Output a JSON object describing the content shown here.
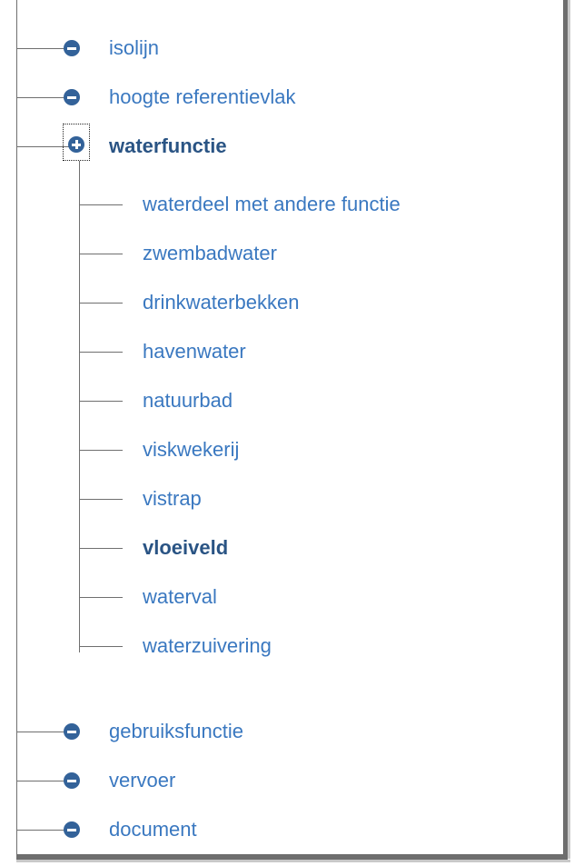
{
  "colors": {
    "link": "#3a78c0",
    "selected": "#2a5484",
    "icon": "#336299",
    "line": "#6f6f6f"
  },
  "tree": {
    "top_items": [
      {
        "label": "isolijn",
        "icon": "minus-circle-icon"
      },
      {
        "label": "hoogte referentievlak",
        "icon": "minus-circle-icon"
      }
    ],
    "expanded": {
      "label": "waterfunctie",
      "icon": "plus-circle-icon",
      "children": [
        {
          "label": "waterdeel met andere functie"
        },
        {
          "label": "zwembadwater"
        },
        {
          "label": "drinkwaterbekken"
        },
        {
          "label": "havenwater"
        },
        {
          "label": "natuurbad"
        },
        {
          "label": "viskwekerij"
        },
        {
          "label": "vistrap"
        },
        {
          "label": "vloeiveld",
          "selected": true
        },
        {
          "label": "waterval"
        },
        {
          "label": "waterzuivering"
        }
      ]
    },
    "bottom_items": [
      {
        "label": "gebruiksfunctie",
        "icon": "minus-circle-icon"
      },
      {
        "label": "vervoer",
        "icon": "minus-circle-icon"
      },
      {
        "label": "document",
        "icon": "minus-circle-icon"
      }
    ]
  }
}
